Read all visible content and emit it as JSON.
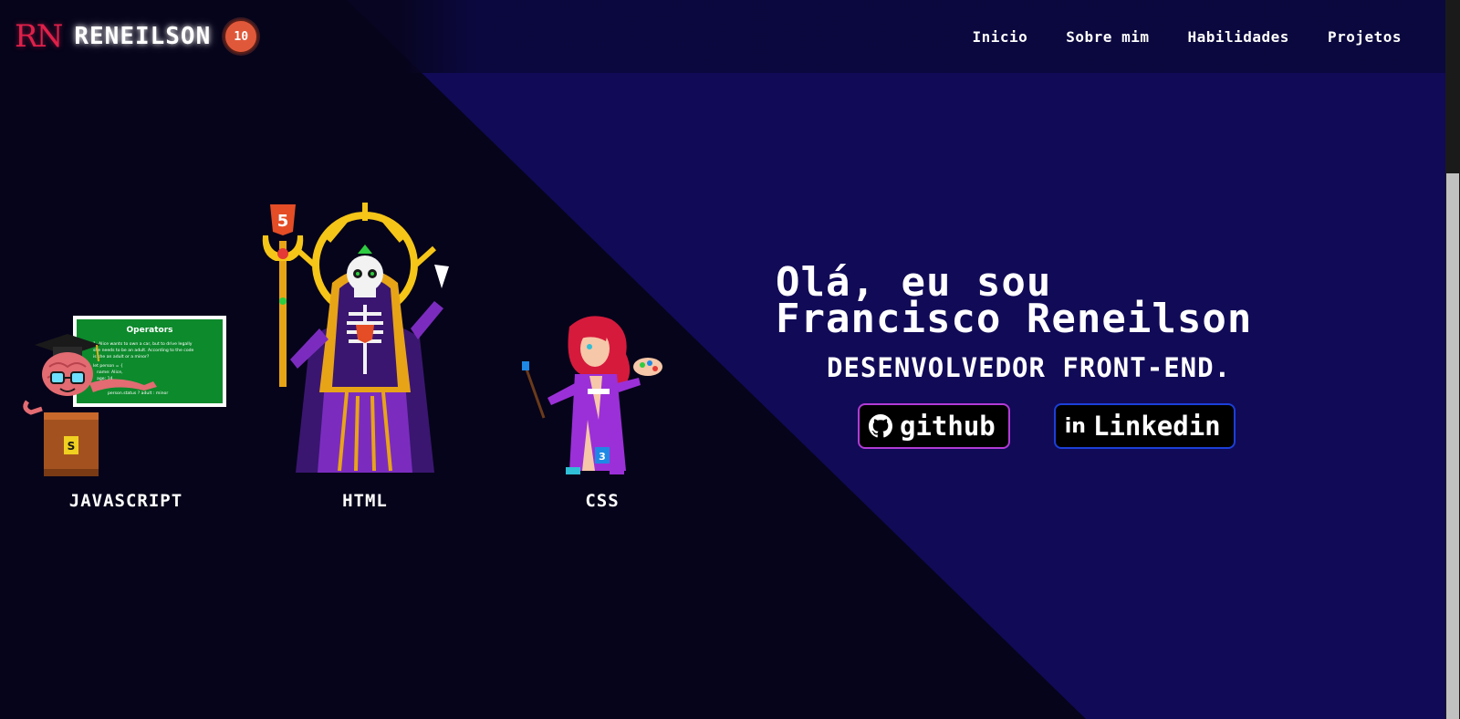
{
  "header": {
    "logo_text": "RN",
    "brand_name": "RENEILSON",
    "level_badge": "10",
    "nav": [
      {
        "label": "Inicio"
      },
      {
        "label": "Sobre mim"
      },
      {
        "label": "Habilidades"
      },
      {
        "label": "Projetos"
      }
    ]
  },
  "characters": {
    "javascript": {
      "label": "JAVASCRIPT",
      "board_title": "Operators",
      "board_lines": [
        "1- Alice wants to own a car, but to drive legally",
        "she needs to be an adult. According to the code",
        "is she an adult or a minor?",
        "let person = {",
        "name: Alice,",
        "age: 14,",
        "}",
        "person.status ? adult : minor"
      ]
    },
    "html": {
      "label": "HTML"
    },
    "css": {
      "label": "CSS"
    }
  },
  "hero": {
    "title_line1": "Olá, eu sou",
    "title_line2": "Francisco Reneilson",
    "subtitle": "DESENVOLVEDOR FRONT-END."
  },
  "social": {
    "github_label": "github",
    "linkedin_label": "Linkedin",
    "linkedin_glyph": "in"
  },
  "colors": {
    "background_dark": "#06041a",
    "background_indigo": "#110a57",
    "logo_red": "#e0204a",
    "badge_orange": "#e0583a",
    "github_border": "#b23bd6",
    "linkedin_border": "#1b3fd8"
  }
}
